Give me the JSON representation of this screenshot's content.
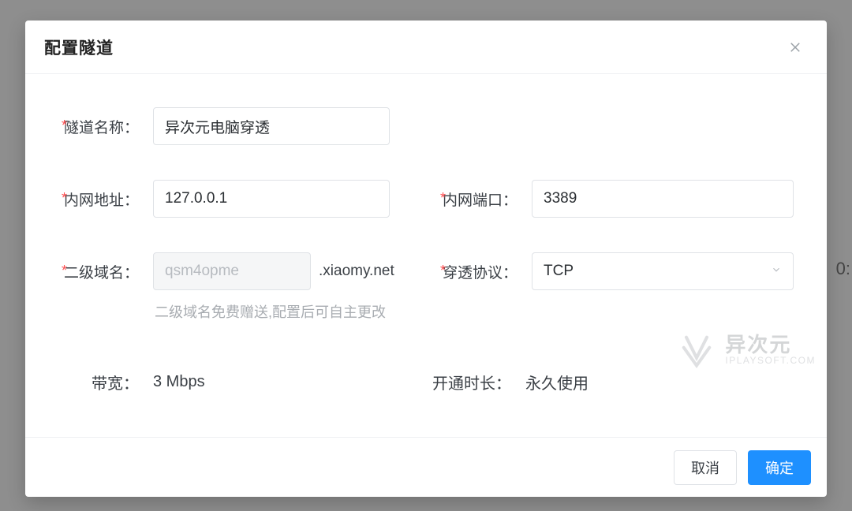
{
  "modal": {
    "title": "配置隧道",
    "close_aria": "关闭"
  },
  "form": {
    "tunnel_name": {
      "label": "隧道名称：",
      "value": "异次元电脑穿透"
    },
    "intranet_addr": {
      "label": "内网地址：",
      "value": "127.0.0.1"
    },
    "intranet_port": {
      "label": "内网端口：",
      "value": "3389"
    },
    "subdomain": {
      "label": "二级域名：",
      "value": "qsm4opme",
      "suffix": ".xiaomy.net",
      "helper": "二级域名免费赠送,配置后可自主更改"
    },
    "protocol": {
      "label": "穿透协议：",
      "value": "TCP"
    },
    "bandwidth": {
      "label": "带宽：",
      "value": "3 Mbps"
    },
    "duration": {
      "label": "开通时长：",
      "value": "永久使用"
    }
  },
  "footer": {
    "cancel": "取消",
    "confirm": "确定"
  },
  "watermark": {
    "cn": "异次元",
    "en": "IPLAYSOFT.COM"
  },
  "background": {
    "fragment": "0:"
  },
  "colors": {
    "primary": "#1e90ff",
    "danger": "#ff4d4f",
    "border": "#dfe2e6"
  }
}
